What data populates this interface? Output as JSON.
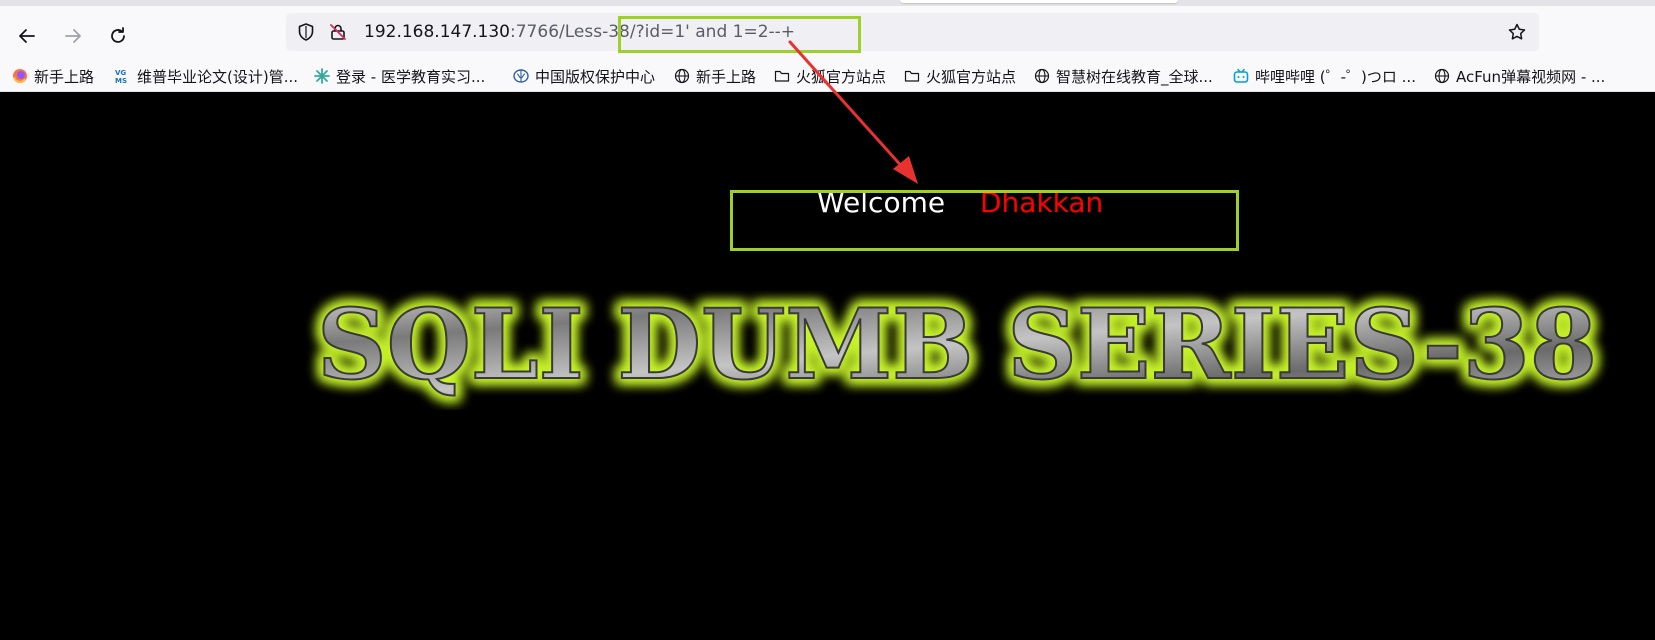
{
  "browser": {
    "url": {
      "host": "192.168.147.130",
      "rest": ":7766/Less-38/?id=1' and 1=2--+"
    },
    "bookmarks": [
      {
        "label": "新手上路",
        "icon": "firefox-icon"
      },
      {
        "label": "维普毕业论文(设计)管...",
        "icon": "vgms-icon"
      },
      {
        "label": "登录 - 医学教育实习...",
        "icon": "snowflake-icon"
      },
      {
        "label": "中国版权保护中心",
        "icon": "brain-icon"
      },
      {
        "label": "新手上路",
        "icon": "globe-icon"
      },
      {
        "label": "火狐官方站点",
        "icon": "folder-icon"
      },
      {
        "label": "火狐官方站点",
        "icon": "folder-icon"
      },
      {
        "label": "智慧树在线教育_全球...",
        "icon": "globe-icon"
      },
      {
        "label": "哔哩哔哩 (゜-゜)つロ ...",
        "icon": "bilibili-icon"
      },
      {
        "label": "AcFun弹幕视频网 - ...",
        "icon": "globe-icon"
      }
    ]
  },
  "page": {
    "welcome": "Welcome",
    "username": "Dhakkan",
    "banner": "SQLI DUMB SERIES-38"
  },
  "annotations": {
    "highlight_color": "#9fcf2b",
    "arrow_color": "#e8322f"
  }
}
